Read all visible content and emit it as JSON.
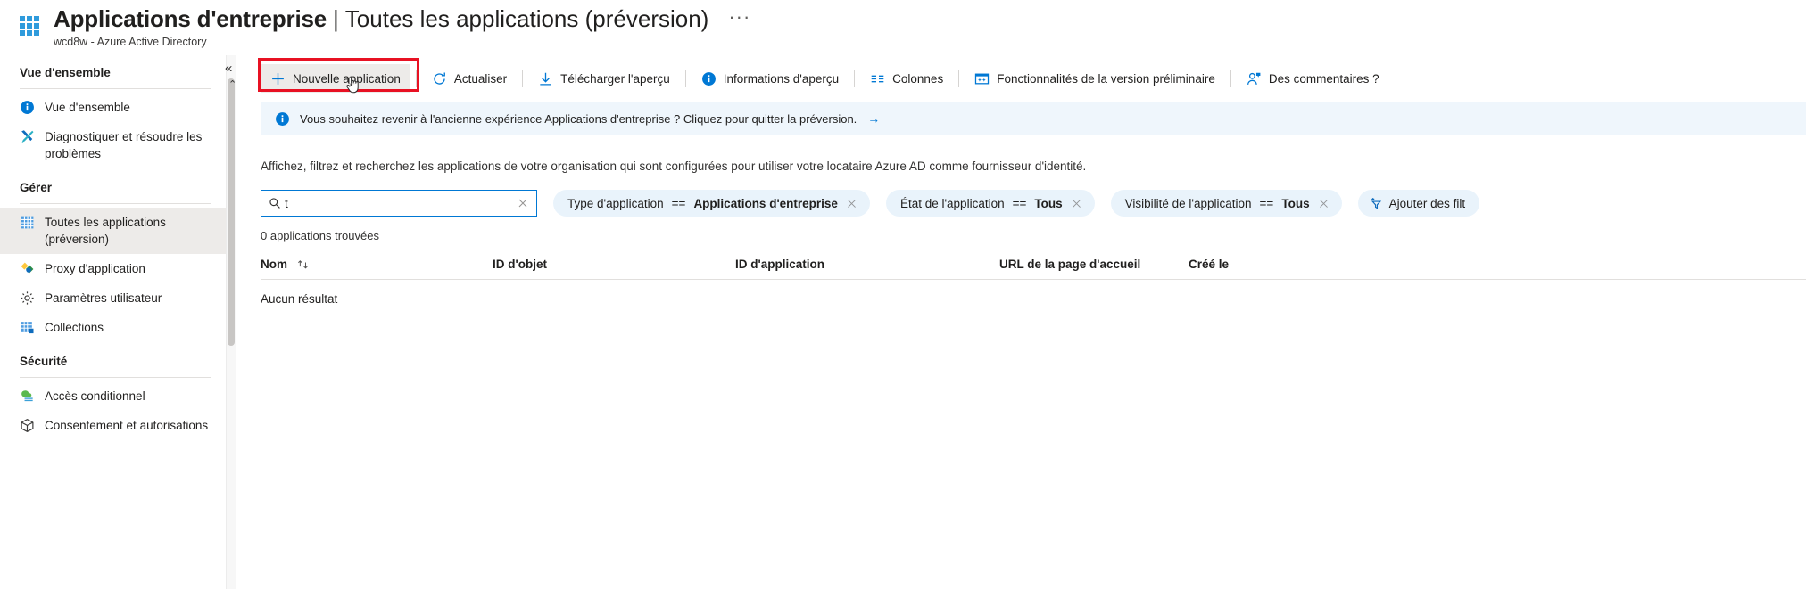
{
  "header": {
    "title_main": "Applications d'entreprise",
    "title_separator": "|",
    "title_sub": "Toutes les applications (préversion)",
    "ellipsis": "···",
    "subtitle": "wcd8w - Azure Active Directory",
    "app_icon": "grid-icon"
  },
  "sidebar": {
    "groups": [
      {
        "title": "Vue d'ensemble",
        "items": [
          {
            "label": "Vue d'ensemble",
            "icon": "info-circle-icon",
            "selected": false
          },
          {
            "label": "Diagnostiquer et résoudre les problèmes",
            "icon": "wrench-screwdriver-icon",
            "selected": false
          }
        ]
      },
      {
        "title": "Gérer",
        "items": [
          {
            "label": "Toutes les applications (préversion)",
            "icon": "grid-icon",
            "selected": true
          },
          {
            "label": "Proxy d'application",
            "icon": "proxy-icon",
            "selected": false
          },
          {
            "label": "Paramètres utilisateur",
            "icon": "gear-icon",
            "selected": false
          },
          {
            "label": "Collections",
            "icon": "collections-icon",
            "selected": false
          }
        ]
      },
      {
        "title": "Sécurité",
        "items": [
          {
            "label": "Accès conditionnel",
            "icon": "conditional-access-icon",
            "selected": false
          },
          {
            "label": "Consentement et autorisations",
            "icon": "cube-icon",
            "selected": false
          }
        ]
      }
    ]
  },
  "toolbar": {
    "collapse_chevron": "«",
    "collapse_up": "⌃",
    "buttons": [
      {
        "label": "Nouvelle application",
        "icon": "plus-icon",
        "highlighted": true
      },
      {
        "label": "Actualiser",
        "icon": "refresh-icon",
        "highlighted": false
      },
      {
        "label": "Télécharger l'aperçu",
        "icon": "download-icon",
        "highlighted": false
      },
      {
        "label": "Informations d'aperçu",
        "icon": "info-filled-icon",
        "highlighted": false
      },
      {
        "label": "Colonnes",
        "icon": "columns-icon",
        "highlighted": false
      },
      {
        "label": "Fonctionnalités de la version préliminaire",
        "icon": "preview-features-icon",
        "highlighted": false
      },
      {
        "label": "Des commentaires ?",
        "icon": "feedback-person-icon",
        "highlighted": false
      }
    ]
  },
  "banner": {
    "icon": "info-filled-icon",
    "text": "Vous souhaitez revenir à l'ancienne expérience Applications d'entreprise ? Cliquez pour quitter la préversion.",
    "arrow": "→"
  },
  "description": "Affichez, filtrez et recherchez les applications de votre organisation qui sont configurées pour utiliser votre locataire Azure AD comme fournisseur d'identité.",
  "search": {
    "value": "t",
    "placeholder": "",
    "icon": "search-icon",
    "clear_icon": "close-icon"
  },
  "filters": [
    {
      "field": "Type d'application",
      "operator": "==",
      "value": "Applications d'entreprise"
    },
    {
      "field": "État de l'application",
      "operator": "==",
      "value": "Tous"
    },
    {
      "field": "Visibilité de l'application",
      "operator": "==",
      "value": "Tous"
    }
  ],
  "add_filter": {
    "label": "Ajouter des filt",
    "icon": "add-filter-icon"
  },
  "results": {
    "count_text": "0 applications trouvées",
    "columns": [
      "Nom",
      "ID d'objet",
      "ID d'application",
      "URL de la page d'accueil",
      "Créé le"
    ],
    "sort_icon": "sort-updown-icon",
    "empty_text": "Aucun résultat",
    "rows": []
  },
  "colors": {
    "accent": "#0078d4",
    "highlight_outline": "#e81123",
    "banner_bg": "#eff6fc",
    "pill_bg": "#e9f3fb",
    "selected_nav_bg": "#edebe9"
  }
}
